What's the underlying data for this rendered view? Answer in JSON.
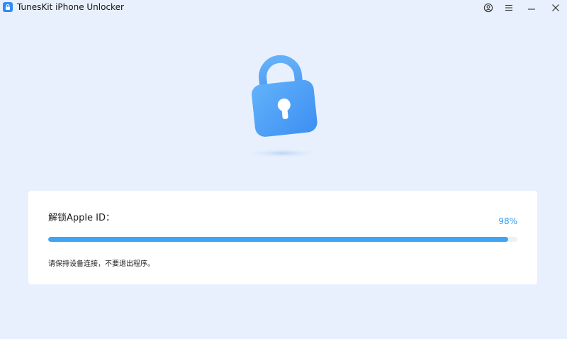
{
  "window": {
    "title": "TunesKit iPhone Unlocker",
    "controls": [
      "account-icon",
      "menu-icon",
      "minimize-icon",
      "close-icon"
    ]
  },
  "hero": {
    "icon": "lock-icon",
    "accent": "#4a9ff7"
  },
  "progress_card": {
    "label": "解锁Apple ID：",
    "percent_text": "98%",
    "progress": 0.98,
    "hint": "请保持设备连接，不要退出程序。",
    "bar_color": "#3fa4f3",
    "track_color": "#eaf1fb"
  }
}
